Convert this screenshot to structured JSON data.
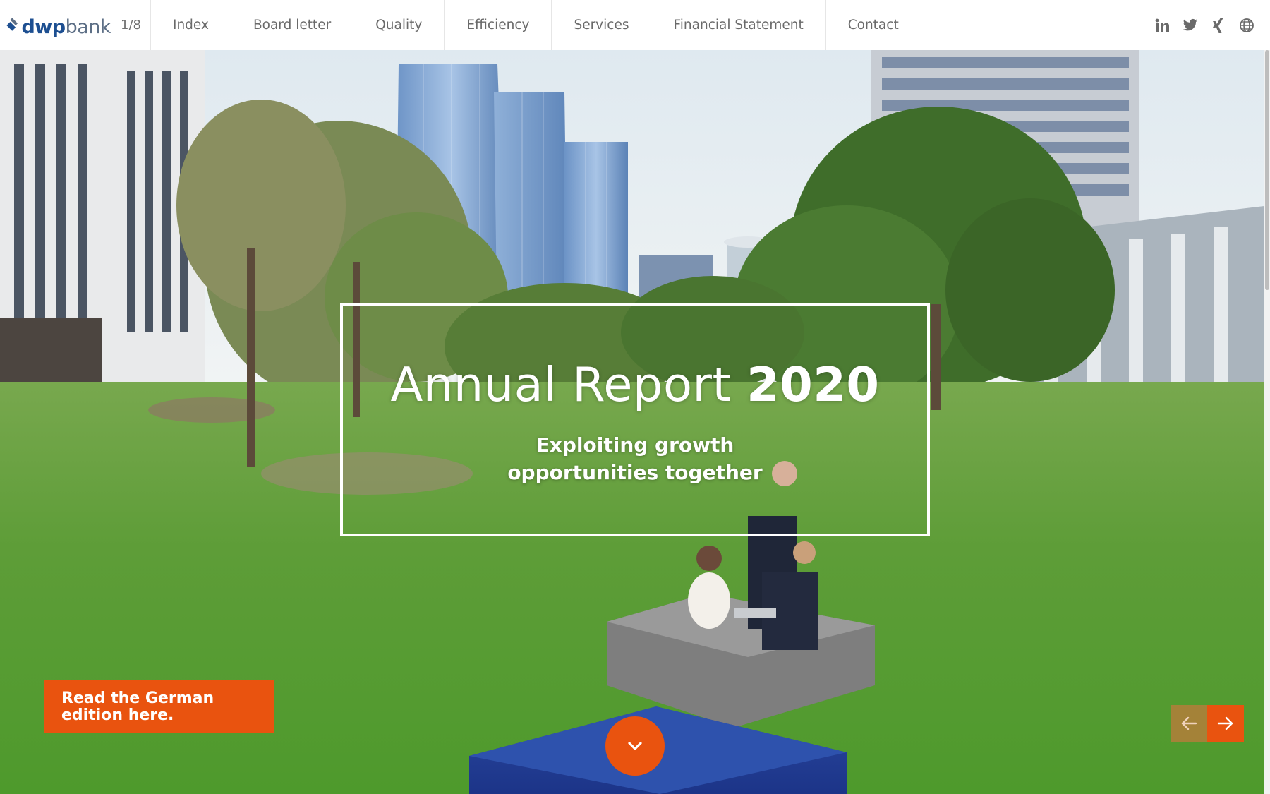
{
  "header": {
    "logo": {
      "part1": "dwp",
      "part2": "bank"
    },
    "pager": "1/8",
    "nav": [
      {
        "label": "Index"
      },
      {
        "label": "Board letter"
      },
      {
        "label": "Quality"
      },
      {
        "label": "Efficiency"
      },
      {
        "label": "Services"
      },
      {
        "label": "Financial Statement"
      },
      {
        "label": "Contact"
      }
    ],
    "social": [
      "linkedin-icon",
      "twitter-icon",
      "xing-icon",
      "globe-icon"
    ]
  },
  "hero": {
    "title_light": "Annual Report",
    "title_bold": "2020",
    "subtitle": "Exploiting growth opportunities together",
    "german_button": "Read the German edition here."
  },
  "colors": {
    "accent": "#e9530f",
    "brand_blue": "#1d4f91",
    "nav_text": "#6a6a6a"
  }
}
